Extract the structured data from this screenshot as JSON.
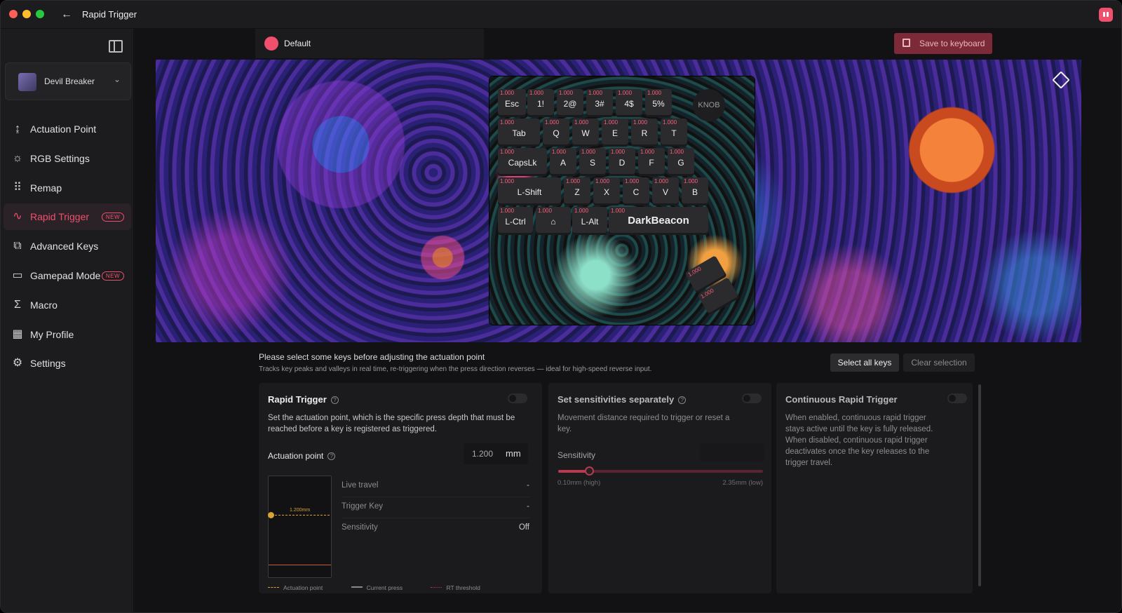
{
  "window": {
    "title": "Rapid Trigger"
  },
  "sidebar": {
    "device": {
      "name": "Devil Breaker"
    },
    "items": [
      {
        "label": "Actuation Point",
        "icon": "actuation-icon"
      },
      {
        "label": "RGB Settings",
        "icon": "sun-icon"
      },
      {
        "label": "Remap",
        "icon": "keyboard-grid-icon"
      },
      {
        "label": "Rapid Trigger",
        "icon": "pulse-icon",
        "badge": "NEW",
        "active": true
      },
      {
        "label": "Advanced Keys",
        "icon": "advanced-keys-icon"
      },
      {
        "label": "Gamepad Mode",
        "icon": "gamepad-icon",
        "badge": "NEW"
      },
      {
        "label": "Macro",
        "icon": "sigma-icon"
      },
      {
        "label": "My Profile",
        "icon": "profile-grid-icon"
      },
      {
        "label": "Settings",
        "icon": "gear-icon"
      }
    ]
  },
  "header": {
    "profile": "Default",
    "save_label": "Save to keyboard"
  },
  "keyboard": {
    "knob_label": "KNOB",
    "keys": [
      {
        "label": "Esc",
        "value": "1.000"
      },
      {
        "label": "1!",
        "value": "1.000"
      },
      {
        "label": "2@",
        "value": "1.000"
      },
      {
        "label": "3#",
        "value": "1.000"
      },
      {
        "label": "4$",
        "value": "1.000"
      },
      {
        "label": "5%",
        "value": "1.000"
      },
      {
        "label": "Tab",
        "value": "1.000"
      },
      {
        "label": "Q",
        "value": "1.000"
      },
      {
        "label": "W",
        "value": "1.000"
      },
      {
        "label": "E",
        "value": "1.000"
      },
      {
        "label": "R",
        "value": "1.000"
      },
      {
        "label": "T",
        "value": "1.000"
      },
      {
        "label": "CapsLk",
        "value": "1.000"
      },
      {
        "label": "A",
        "value": "1.000"
      },
      {
        "label": "S",
        "value": "1.000"
      },
      {
        "label": "D",
        "value": "1.000"
      },
      {
        "label": "F",
        "value": "1.000"
      },
      {
        "label": "G",
        "value": "1.000"
      },
      {
        "label": "L-Shift",
        "value": "1.000"
      },
      {
        "label": "Z",
        "value": "1.000"
      },
      {
        "label": "X",
        "value": "1.000"
      },
      {
        "label": "C",
        "value": "1.000"
      },
      {
        "label": "V",
        "value": "1.000"
      },
      {
        "label": "B",
        "value": "1.000"
      },
      {
        "label": "L-Ctrl",
        "value": "1.000"
      },
      {
        "label": "",
        "value": "1.000",
        "icon": "fn-icon"
      },
      {
        "label": "L-Alt",
        "value": "1.000"
      },
      {
        "label": "DarkBeacon",
        "value": "1.000"
      },
      {
        "label": "",
        "value": "1.000"
      },
      {
        "label": "",
        "value": "1.000"
      }
    ]
  },
  "info": {
    "title": "Please select some keys before adjusting the actuation point",
    "subtitle": "Tracks key peaks and valleys in real time, re-triggering when the press direction reverses — ideal for high-speed reverse input.",
    "select_all": "Select all keys",
    "clear": "Clear selection"
  },
  "rapid_trigger": {
    "title": "Rapid Trigger",
    "help": "?",
    "desc": "Set the actuation point, which is the specific press depth that must be reached before a key is registered as triggered.",
    "actuation_label": "Actuation point",
    "actuation_value": "1.200",
    "unit": "mm",
    "viz_label": "1.200mm",
    "stats": [
      {
        "key": "Live travel",
        "value": "-"
      },
      {
        "key": "Trigger Key",
        "value": "-"
      },
      {
        "key": "Sensitivity",
        "value": "Off"
      }
    ],
    "legend": [
      "Actuation point",
      "Current press",
      "RT threshold"
    ],
    "enabled": false
  },
  "sensitivities": {
    "title": "Set sensitivities separately",
    "help": "?",
    "desc": "Movement distance required to trigger or reset a key.",
    "label": "Sensitivity",
    "min_label": "0.10mm (high)",
    "max_label": "2.35mm (low)",
    "slider_fraction": 0.15,
    "enabled": false
  },
  "continuous": {
    "title": "Continuous Rapid Trigger",
    "desc": "When enabled, continuous rapid trigger stays active until the key is fully released. When disabled, continuous rapid trigger deactivates once the key releases to the trigger travel.",
    "enabled": false
  },
  "colors": {
    "accent": "#f0506e",
    "save_bg": "#7d2a38",
    "actuation": "#d9a430"
  }
}
